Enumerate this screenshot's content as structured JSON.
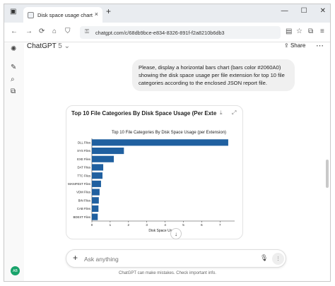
{
  "browser": {
    "tab_title": "Disk space usage chart",
    "tab_close": "×",
    "new_tab": "+",
    "url": "chatgpt.com/c/68db9bce-e834-8326-891f-f2a8210b6db3",
    "window_minimize": "—",
    "window_maximize": "☐",
    "window_close": "✕"
  },
  "header": {
    "app_name": "ChatGPT",
    "version": "5",
    "share_label": "Share"
  },
  "user_message": "Please, display a horizontal bars chart (bars color #2060A0) showing the disk space usage per file extension for top 10 file categories according to the enclosed JSON report file.",
  "card": {
    "title": "Top 10 File Categories By Disk Space Usage (Per Extension)"
  },
  "composer": {
    "placeholder": "Ask anything"
  },
  "disclaimer": "ChatGPT can make mistakes. Check important info.",
  "avatar_initials": "AB",
  "colors": {
    "bar": "#2060A0"
  },
  "chart_data": {
    "type": "bar",
    "orientation": "horizontal",
    "title": "Top 10 File Categories By Disk Space Usage (per Extension)",
    "xlabel": "Disk Space Usage",
    "ylabel": "",
    "categories": [
      "DLL Files",
      "SYS Files",
      "EXE Files",
      "DAT Files",
      "TTC Files",
      "MANIFEST Files",
      "VDM Files",
      "BIN Files",
      "CAB Files",
      "BDEXT Files"
    ],
    "values": [
      7.45,
      1.75,
      1.2,
      0.62,
      0.58,
      0.5,
      0.42,
      0.38,
      0.36,
      0.32
    ],
    "xticks": [
      0,
      1,
      2,
      3,
      4,
      5,
      6,
      7
    ],
    "xlim": [
      0,
      7.8
    ],
    "grid": false
  }
}
